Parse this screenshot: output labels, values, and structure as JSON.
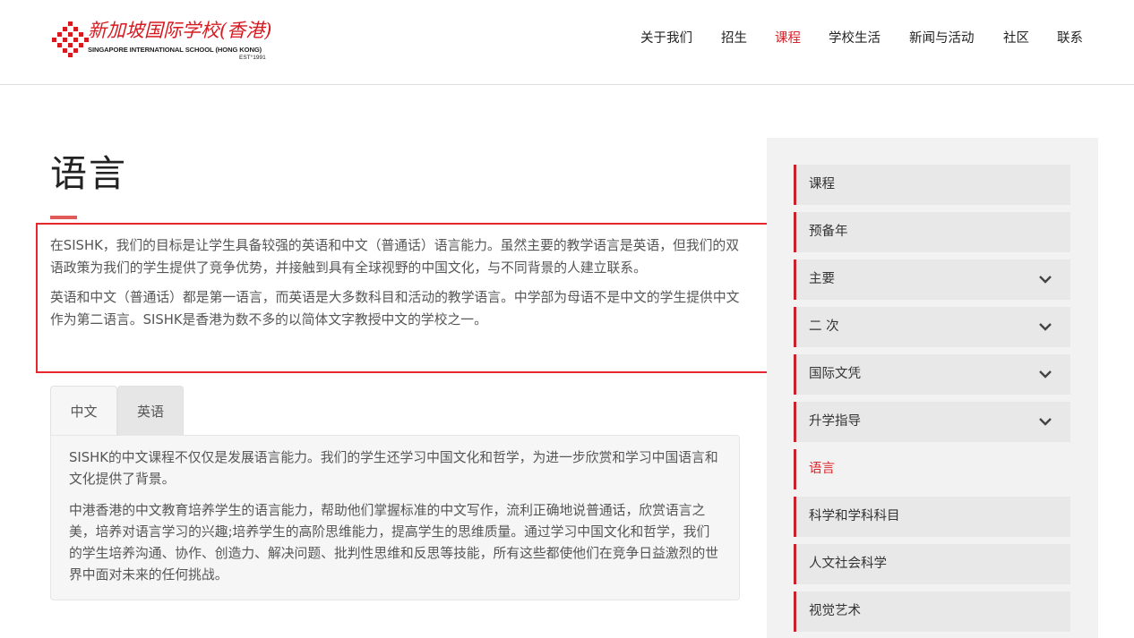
{
  "header": {
    "logo": {
      "cn": "新加坡国际学校(香港)",
      "en": "SINGAPORE INTERNATIONAL SCHOOL (HONG KONG)",
      "est": "EST°1991"
    },
    "nav": [
      {
        "label": "关于我们"
      },
      {
        "label": "招生"
      },
      {
        "label": "课程",
        "active": true
      },
      {
        "label": "学校生活"
      },
      {
        "label": "新闻与活动"
      },
      {
        "label": "社区"
      },
      {
        "label": "联系"
      }
    ]
  },
  "main": {
    "title": "语言",
    "intro": [
      "在SISHK，我们的目标是让学生具备较强的英语和中文（普通话）语言能力。虽然主要的教学语言是英语，但我们的双语政策为我们的学生提供了竞争优势，并接触到具有全球视野的中国文化，与不同背景的人建立联系。",
      "英语和中文（普通话）都是第一语言，而英语是大多数科目和活动的教学语言。中学部为母语不是中文的学生提供中文作为第二语言。SISHK是香港为数不多的以简体文字教授中文的学校之一。"
    ],
    "tabs": [
      {
        "label": "中文",
        "active": true
      },
      {
        "label": "英语"
      }
    ],
    "panel": [
      "SISHK的中文课程不仅仅是发展语言能力。我们的学生还学习中国文化和哲学，为进一步欣赏和学习中国语言和文化提供了背景。",
      "中港香港的中文教育培养学生的语言能力，帮助他们掌握标准的中文写作，流利正确地说普通话，欣赏语言之美，培养对语言学习的兴趣;培养学生的高阶思维能力，提高学生的思维质量。通过学习中国文化和哲学，我们的学生培养沟通、协作、创造力、解决问题、批判性思维和反思等技能，所有这些都使他们在竞争日益激烈的世界中面对未来的任何挑战。"
    ]
  },
  "sidebar": {
    "items": [
      {
        "label": "课程"
      },
      {
        "label": "预备年"
      },
      {
        "label": "主要",
        "expandable": true
      },
      {
        "label": "二 次",
        "expandable": true
      },
      {
        "label": "国际文凭",
        "expandable": true
      },
      {
        "label": "升学指导",
        "expandable": true
      },
      {
        "label": "语言",
        "active": true
      },
      {
        "label": "科学和学科科目"
      },
      {
        "label": "人文社会科学"
      },
      {
        "label": "视觉艺术"
      }
    ]
  },
  "colors": {
    "accent": "#d9262c",
    "highlight_border": "#e8262c",
    "sidebar_bg": "#f2f2f2",
    "sidebar_item_bg": "#e8e8e8"
  },
  "icons": {
    "logo_mark": "red-checker-logo-icon",
    "chevron": "chevron-down-icon"
  }
}
